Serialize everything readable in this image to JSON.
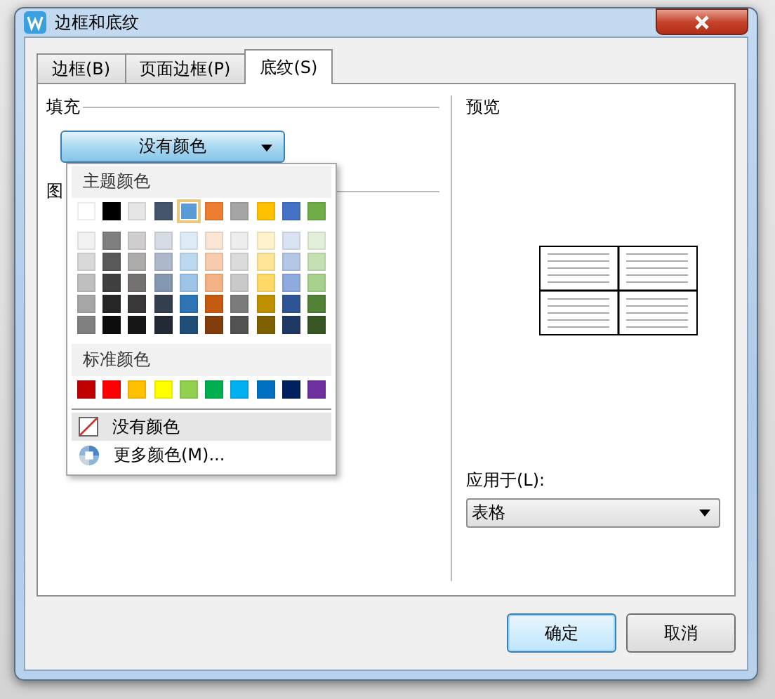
{
  "window": {
    "title": "边框和底纹"
  },
  "tabs": [
    {
      "label": "边框(B)",
      "selected": false
    },
    {
      "label": "页面边框(P)",
      "selected": false
    },
    {
      "label": "底纹(S)",
      "selected": true
    }
  ],
  "fill": {
    "label": "填充",
    "value": "没有颜色"
  },
  "pattern": {
    "label": "图"
  },
  "color_menu": {
    "theme_heading": "主题颜色",
    "theme_colors": [
      {
        "color": "#ffffff",
        "selected": false
      },
      {
        "color": "#000000",
        "selected": false
      },
      {
        "color": "#e7e6e6",
        "selected": false
      },
      {
        "color": "#44546a",
        "selected": false
      },
      {
        "color": "#5b9bd5",
        "selected": true
      },
      {
        "color": "#ed7d31",
        "selected": false
      },
      {
        "color": "#a5a5a5",
        "selected": false
      },
      {
        "color": "#ffc000",
        "selected": false
      },
      {
        "color": "#4472c4",
        "selected": false
      },
      {
        "color": "#70ad47",
        "selected": false
      }
    ],
    "shade_rows": [
      {
        "swatches": [
          {
            "color": "#f2f2f2"
          },
          {
            "color": "#7f7f7f"
          },
          {
            "color": "#d0cece"
          },
          {
            "color": "#d6dce4"
          },
          {
            "color": "#deebf6"
          },
          {
            "color": "#fbe5d5"
          },
          {
            "color": "#ededed"
          },
          {
            "color": "#fff2cc"
          },
          {
            "color": "#dae3f3"
          },
          {
            "color": "#e2efd9"
          }
        ]
      },
      {
        "swatches": [
          {
            "color": "#d9d9d9"
          },
          {
            "color": "#595959"
          },
          {
            "color": "#aeabab"
          },
          {
            "color": "#adb9ca"
          },
          {
            "color": "#bdd7ee"
          },
          {
            "color": "#f7cbac"
          },
          {
            "color": "#dbdbdb"
          },
          {
            "color": "#fee599"
          },
          {
            "color": "#b4c7e7"
          },
          {
            "color": "#c5e0b3"
          }
        ]
      },
      {
        "swatches": [
          {
            "color": "#bfbfbf"
          },
          {
            "color": "#404040"
          },
          {
            "color": "#757171"
          },
          {
            "color": "#8497b0"
          },
          {
            "color": "#9dc3e6"
          },
          {
            "color": "#f4b183"
          },
          {
            "color": "#c9c9c9"
          },
          {
            "color": "#ffd965"
          },
          {
            "color": "#8faadc"
          },
          {
            "color": "#a8d08d"
          }
        ]
      },
      {
        "swatches": [
          {
            "color": "#a6a6a6"
          },
          {
            "color": "#262626"
          },
          {
            "color": "#3a3838"
          },
          {
            "color": "#333f4f"
          },
          {
            "color": "#2e75b5"
          },
          {
            "color": "#c55a11"
          },
          {
            "color": "#7b7b7b"
          },
          {
            "color": "#bf9000"
          },
          {
            "color": "#2f5496"
          },
          {
            "color": "#538135"
          }
        ]
      },
      {
        "swatches": [
          {
            "color": "#808080"
          },
          {
            "color": "#0d0d0d"
          },
          {
            "color": "#171616"
          },
          {
            "color": "#222a35"
          },
          {
            "color": "#1f4e79"
          },
          {
            "color": "#833c0b"
          },
          {
            "color": "#525252"
          },
          {
            "color": "#7f6000"
          },
          {
            "color": "#1f3864"
          },
          {
            "color": "#375623"
          }
        ]
      }
    ],
    "standard_heading": "标准颜色",
    "standard_colors": [
      {
        "color": "#c00000"
      },
      {
        "color": "#ff0000"
      },
      {
        "color": "#ffc000"
      },
      {
        "color": "#ffff00"
      },
      {
        "color": "#92d050"
      },
      {
        "color": "#00b050"
      },
      {
        "color": "#00b0f0"
      },
      {
        "color": "#0070c0"
      },
      {
        "color": "#002060"
      },
      {
        "color": "#7030a0"
      }
    ],
    "items": [
      {
        "kind": "none",
        "label": "没有颜色",
        "selected": true
      },
      {
        "kind": "more",
        "label": "更多颜色(M)...",
        "selected": false
      }
    ]
  },
  "preview": {
    "label": "预览"
  },
  "apply_to": {
    "label": "应用于(L):",
    "value": "表格"
  },
  "buttons": [
    {
      "label": "确定",
      "default": true
    },
    {
      "label": "取消",
      "default": false
    }
  ]
}
